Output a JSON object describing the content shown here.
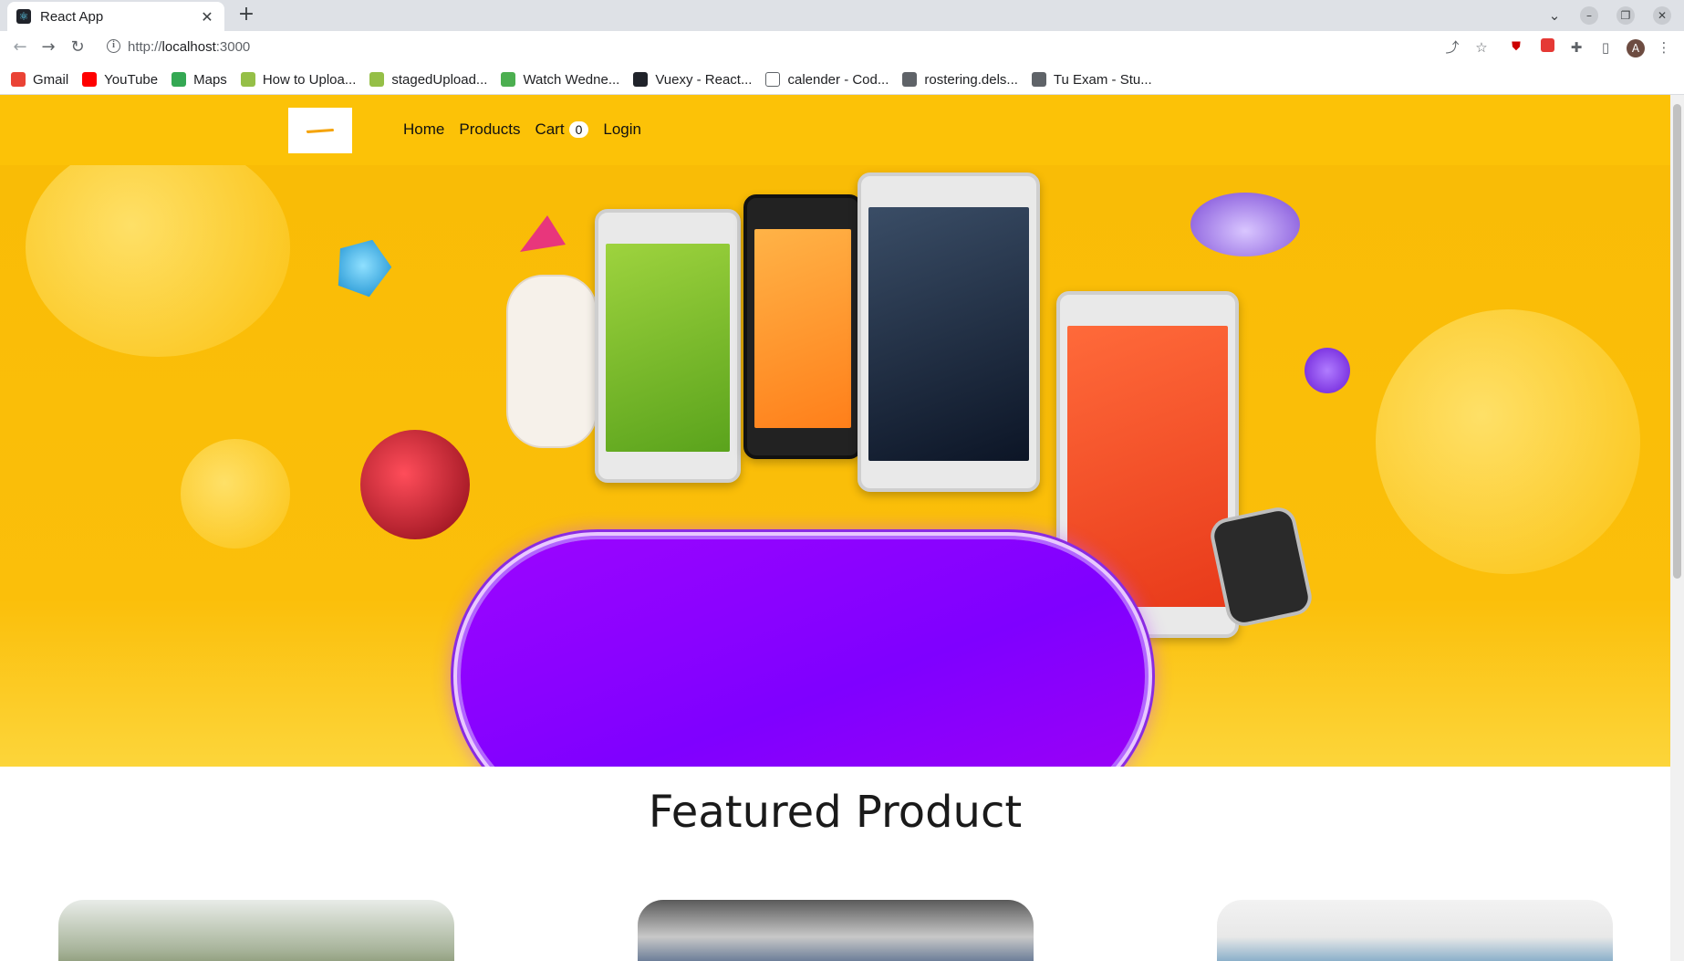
{
  "browser": {
    "tab_title": "React App",
    "url_scheme": "http://",
    "url_host": "localhost",
    "url_port": ":3000",
    "bookmarks": [
      {
        "label": "Gmail",
        "icon": "gmail-icon",
        "color": "#ea4335"
      },
      {
        "label": "YouTube",
        "icon": "youtube-icon",
        "color": "#ff0000"
      },
      {
        "label": "Maps",
        "icon": "maps-icon",
        "color": "#34a853"
      },
      {
        "label": "How to Uploa...",
        "icon": "shopify-icon",
        "color": "#95bf47"
      },
      {
        "label": "stagedUpload...",
        "icon": "shopify-icon",
        "color": "#95bf47"
      },
      {
        "label": "Watch Wedne...",
        "icon": "play-icon",
        "color": "#4caf50"
      },
      {
        "label": "Vuexy - React...",
        "icon": "react-icon",
        "color": "#20232a"
      },
      {
        "label": "calender - Cod...",
        "icon": "page-icon",
        "color": "#ffffff"
      },
      {
        "label": "rostering.dels...",
        "icon": "globe-icon",
        "color": "#5f6368"
      },
      {
        "label": "Tu Exam - Stu...",
        "icon": "globe-icon",
        "color": "#5f6368"
      }
    ]
  },
  "header": {
    "nav": [
      {
        "label": "Home"
      },
      {
        "label": "Products"
      }
    ],
    "cart_label": "Cart",
    "cart_count": "0",
    "login_label": "Login",
    "accent_color": "#fcc207"
  },
  "featured": {
    "title": "Featured Product"
  }
}
